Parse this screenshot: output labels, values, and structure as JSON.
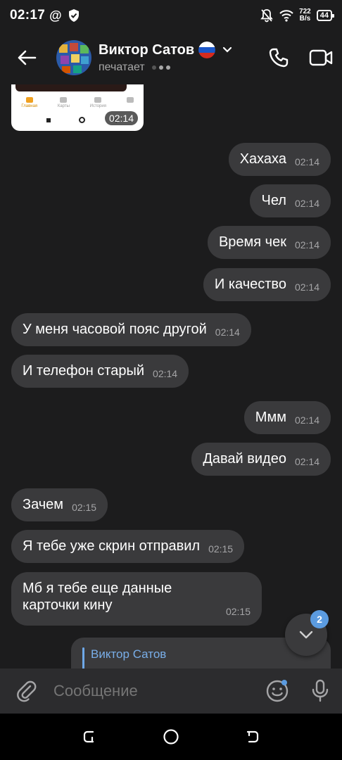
{
  "status_bar": {
    "time": "02:17",
    "at_symbol": "@",
    "net_speed_value": "722",
    "net_speed_unit": "B/s",
    "battery": "44"
  },
  "header": {
    "contact_name": "Виктор Сатов",
    "status": "печатает"
  },
  "photo_message": {
    "tabs": [
      "Главная",
      "Карты",
      "История",
      ""
    ],
    "time": "02:14"
  },
  "messages": [
    {
      "text": "Хахаха",
      "time": "02:14",
      "direction": "out"
    },
    {
      "text": "Чел",
      "time": "02:14",
      "direction": "out"
    },
    {
      "text": "Время чек",
      "time": "02:14",
      "direction": "out"
    },
    {
      "text": "И качество",
      "time": "02:14",
      "direction": "out"
    },
    {
      "text": "У меня часовой пояс другой",
      "time": "02:14",
      "direction": "in"
    },
    {
      "text": "И телефон старый",
      "time": "02:14",
      "direction": "in"
    },
    {
      "text": "Ммм",
      "time": "02:14",
      "direction": "out"
    },
    {
      "text": "Давай видео",
      "time": "02:14",
      "direction": "out"
    },
    {
      "text": "Зачем",
      "time": "02:15",
      "direction": "in"
    },
    {
      "text": "Я тебе уже скрин отправил",
      "time": "02:15",
      "direction": "in"
    },
    {
      "text": "Мб я тебе еще данные карточки кину",
      "time": "02:15",
      "direction": "in"
    }
  ],
  "reply_message": {
    "reply_name": "Виктор Сатов"
  },
  "scroll_down": {
    "unread_count": "2"
  },
  "input": {
    "placeholder": "Сообщение"
  },
  "colors": {
    "background": "#1c1c1d",
    "bubble": "#3a3a3c",
    "accent": "#5b9be0",
    "time_text": "#a5a5a7"
  },
  "icons": [
    "back-arrow-icon",
    "phone-icon",
    "video-camera-icon",
    "chevron-down-icon",
    "paperclip-icon",
    "emoji-icon",
    "microphone-icon",
    "shield-icon",
    "wifi-icon",
    "mute-bell-icon"
  ]
}
